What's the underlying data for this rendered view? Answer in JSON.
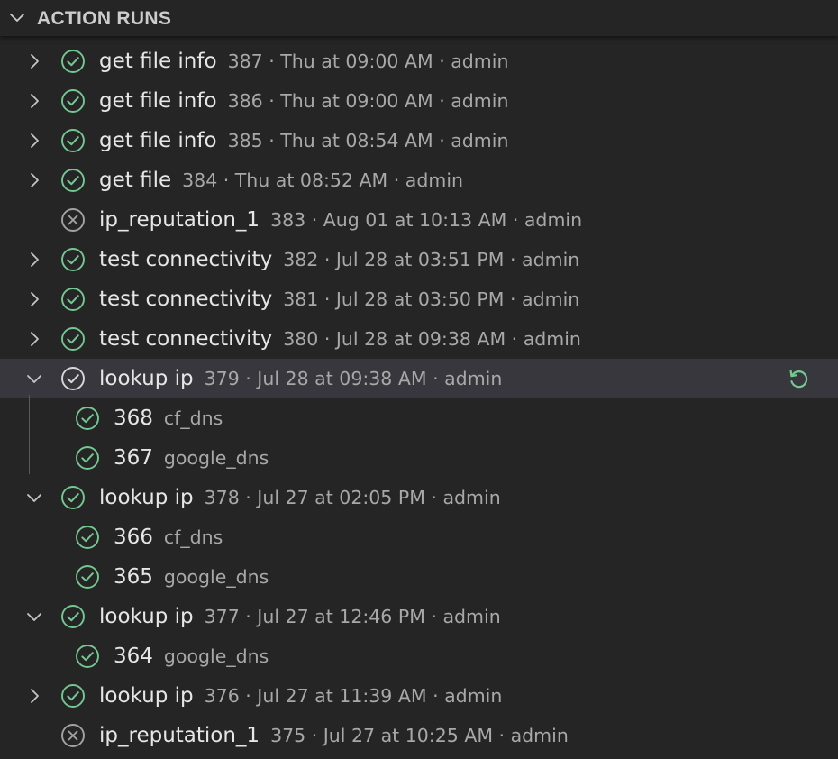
{
  "panel": {
    "title": "ACTION RUNS"
  },
  "colors": {
    "success": "#73c991",
    "failed": "#a3a3a3",
    "text": "#e6e6e6",
    "muted": "#a8a8a8",
    "selected_bg": "#37373d"
  },
  "icons": {
    "success": "check-circle-icon",
    "failed": "x-circle-icon",
    "expand": "chevron-right-icon",
    "collapse": "chevron-down-icon",
    "rerun": "rerun-icon"
  },
  "runs": [
    {
      "kind": "top",
      "twisty": "collapsed",
      "status": "success",
      "name": "get file info",
      "desc": "387 · Thu at 09:00 AM · admin"
    },
    {
      "kind": "top",
      "twisty": "collapsed",
      "status": "success",
      "name": "get file info",
      "desc": "386 · Thu at 09:00 AM · admin"
    },
    {
      "kind": "top",
      "twisty": "collapsed",
      "status": "success",
      "name": "get file info",
      "desc": "385 · Thu at 08:54 AM · admin"
    },
    {
      "kind": "top",
      "twisty": "collapsed",
      "status": "success",
      "name": "get file",
      "desc": "384 · Thu at 08:52 AM · admin"
    },
    {
      "kind": "top",
      "twisty": "none",
      "status": "failed",
      "name": "ip_reputation_1",
      "desc": "383 · Aug 01 at 10:13 AM · admin"
    },
    {
      "kind": "top",
      "twisty": "collapsed",
      "status": "success",
      "name": "test connectivity",
      "desc": "382 · Jul 28 at 03:51 PM · admin"
    },
    {
      "kind": "top",
      "twisty": "collapsed",
      "status": "success",
      "name": "test connectivity",
      "desc": "381 · Jul 28 at 03:50 PM · admin"
    },
    {
      "kind": "top",
      "twisty": "collapsed",
      "status": "success",
      "name": "test connectivity",
      "desc": "380 · Jul 28 at 09:38 AM · admin"
    },
    {
      "kind": "top",
      "twisty": "expanded",
      "status": "success-selected",
      "name": "lookup ip",
      "desc": "379 · Jul 28 at 09:38 AM · admin",
      "selected": true,
      "rerun": true
    },
    {
      "kind": "child",
      "twisty": "none",
      "status": "success",
      "name": "368",
      "desc": "cf_dns"
    },
    {
      "kind": "child",
      "twisty": "none",
      "status": "success",
      "name": "367",
      "desc": "google_dns"
    },
    {
      "kind": "top",
      "twisty": "expanded",
      "status": "success",
      "name": "lookup ip",
      "desc": "378 · Jul 27 at 02:05 PM · admin"
    },
    {
      "kind": "child",
      "twisty": "none",
      "status": "success",
      "name": "366",
      "desc": "cf_dns"
    },
    {
      "kind": "child",
      "twisty": "none",
      "status": "success",
      "name": "365",
      "desc": "google_dns"
    },
    {
      "kind": "top",
      "twisty": "expanded",
      "status": "success",
      "name": "lookup ip",
      "desc": "377 · Jul 27 at 12:46 PM · admin"
    },
    {
      "kind": "child",
      "twisty": "none",
      "status": "success",
      "name": "364",
      "desc": "google_dns"
    },
    {
      "kind": "top",
      "twisty": "collapsed",
      "status": "success",
      "name": "lookup ip",
      "desc": "376 · Jul 27 at 11:39 AM · admin"
    },
    {
      "kind": "top",
      "twisty": "none",
      "status": "failed",
      "name": "ip_reputation_1",
      "desc": "375 · Jul 27 at 10:25 AM · admin"
    }
  ]
}
